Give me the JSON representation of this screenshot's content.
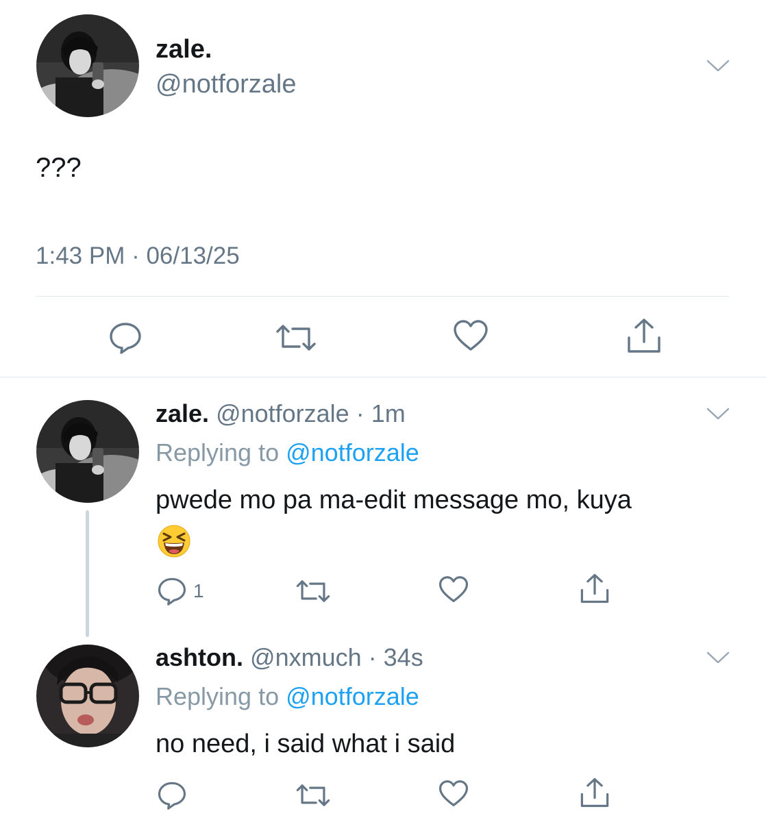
{
  "main_tweet": {
    "display_name": "zale.",
    "handle": "@notforzale",
    "text": "???",
    "timestamp": "1:43 PM · 06/13/25",
    "actions": [
      "reply-icon",
      "retweet-icon",
      "like-icon",
      "share-icon"
    ]
  },
  "replies": [
    {
      "display_name": "zale.",
      "handle": "@notforzale",
      "age": "· 1m",
      "replying_prefix": "Replying to ",
      "replying_to": "@notforzale",
      "text": "pwede mo pa ma-edit message mo, kuya",
      "emoji": "laughing-squinting-face",
      "reply_count": "1"
    },
    {
      "display_name": "ashton.",
      "handle": "@nxmuch",
      "age": "· 34s",
      "replying_prefix": "Replying to ",
      "replying_to": "@notforzale",
      "text": "no need, i said what i said"
    }
  ],
  "colors": {
    "secondary_text": "#657786",
    "mention": "#1da1f2",
    "icon": "#657786",
    "divider": "#e1e8ed",
    "thread_line": "#ccd6dd"
  }
}
